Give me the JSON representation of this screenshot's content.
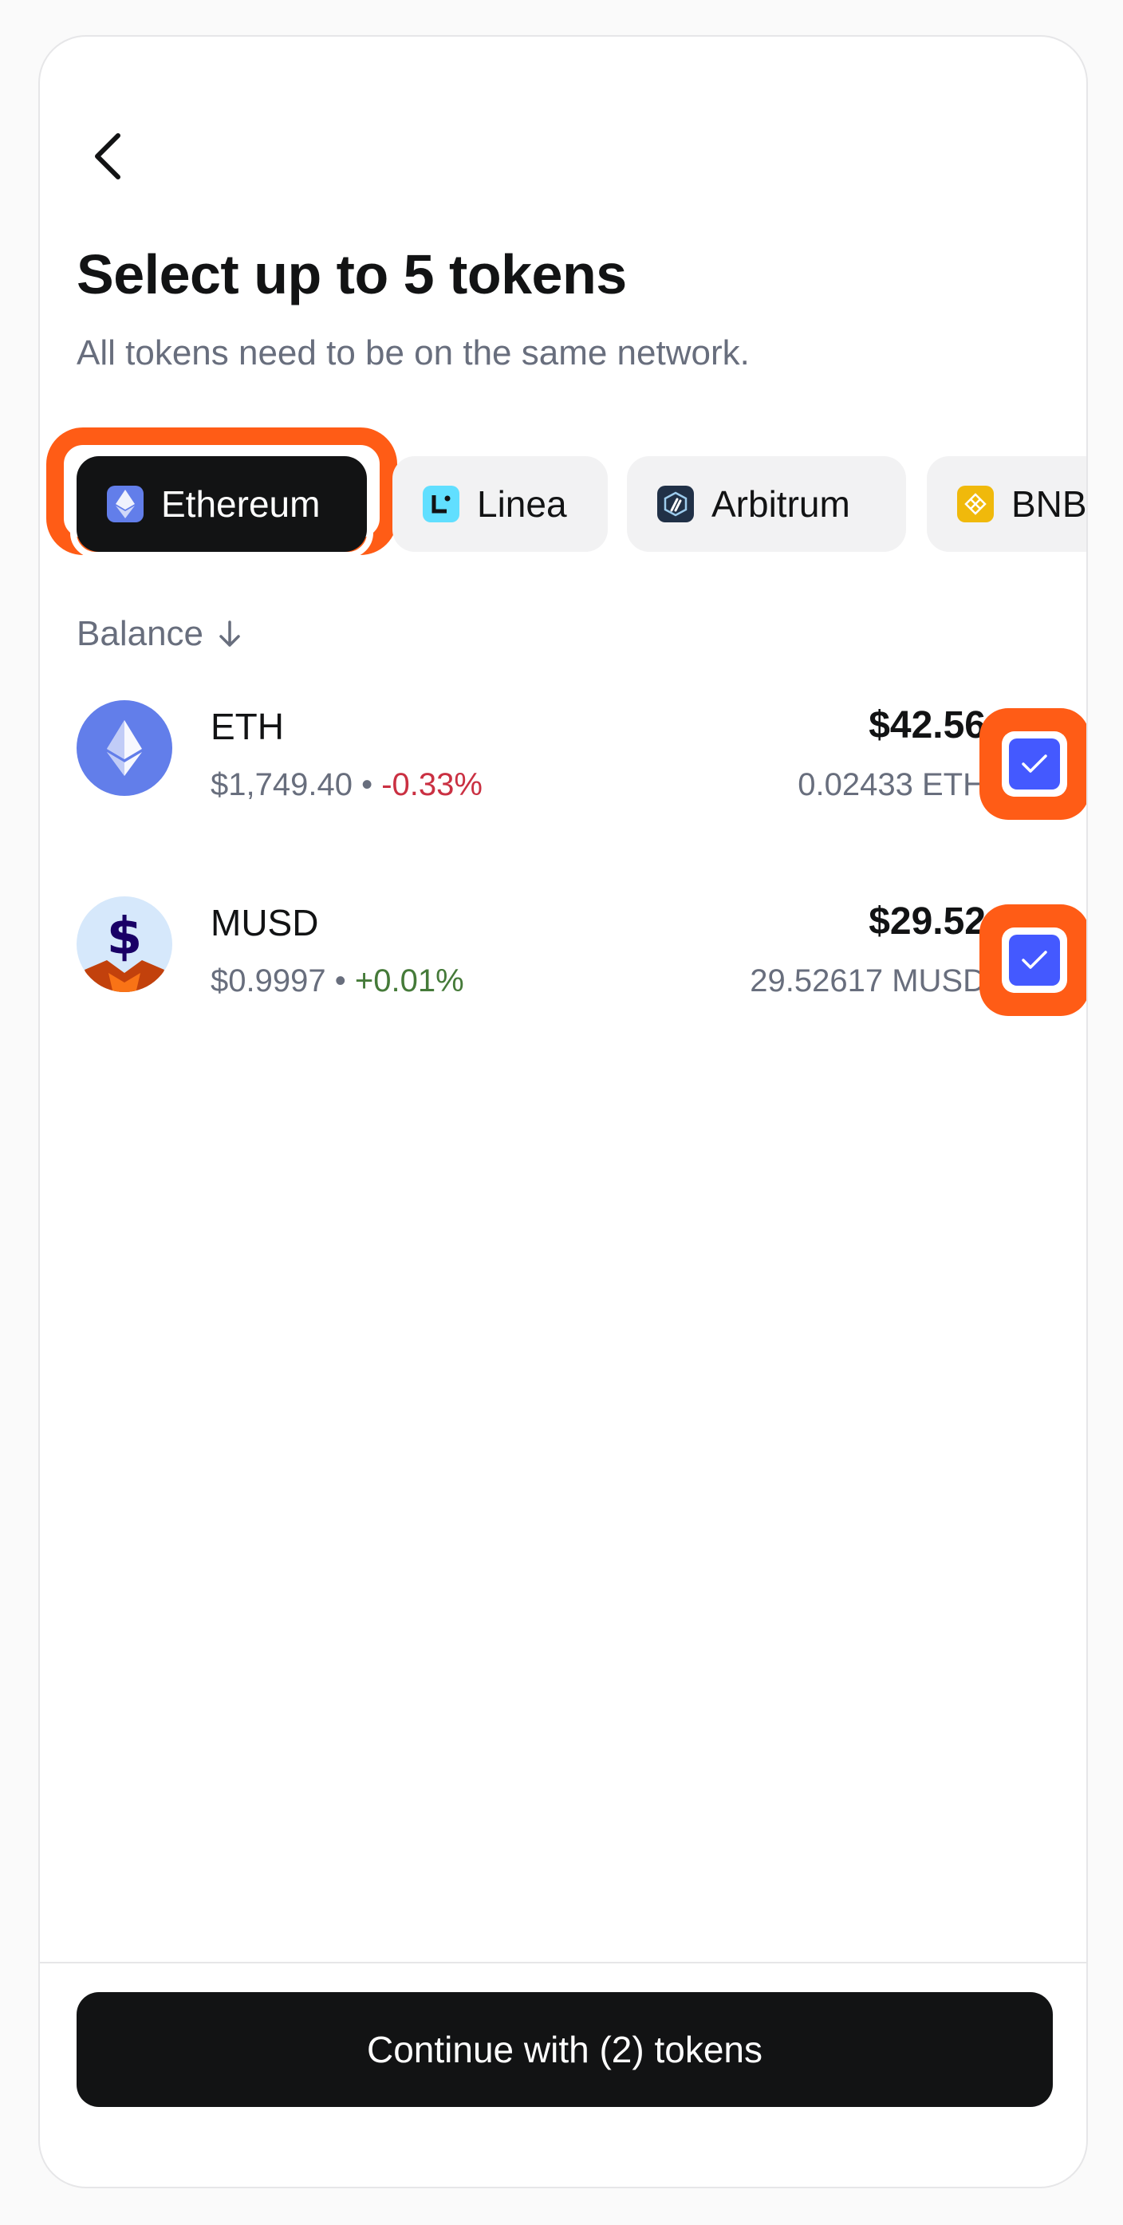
{
  "header": {
    "title": "Select up to 5 tokens",
    "subtitle": "All tokens need to be on the same network."
  },
  "networks": [
    {
      "label": "Ethereum",
      "icon": "ethereum-icon",
      "active": true
    },
    {
      "label": "Linea",
      "icon": "linea-icon",
      "active": false
    },
    {
      "label": "Arbitrum",
      "icon": "arbitrum-icon",
      "active": false
    },
    {
      "label": "BNB",
      "icon": "bnb-icon",
      "active": false
    }
  ],
  "sort": {
    "label": "Balance",
    "icon": "arrow-down-icon"
  },
  "tokens": [
    {
      "symbol": "ETH",
      "price": "$1,749.40",
      "separator": "•",
      "change": "-0.33%",
      "fiat": "$42.56",
      "amount": "0.02433 ETH",
      "selected": true
    },
    {
      "symbol": "MUSD",
      "price": "$0.9997",
      "separator": "•",
      "change": "+0.01%",
      "fiat": "$29.52",
      "amount": "29.52617 MUSD",
      "selected": true
    }
  ],
  "footer": {
    "continue_label": "Continue with (2) tokens"
  },
  "colors": {
    "accent": "#4459ff",
    "highlight": "#ff5c16",
    "negative": "#ca3042",
    "positive": "#457a39",
    "primary_dark": "#121314"
  }
}
